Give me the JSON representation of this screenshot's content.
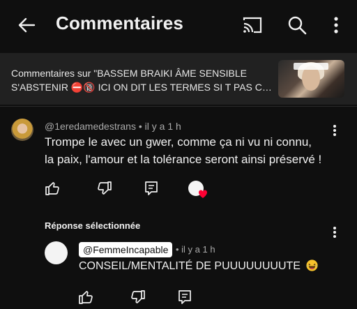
{
  "header": {
    "title": "Commentaires"
  },
  "video": {
    "line1": "Commentaires sur \"BASSEM BRAIKI ÂME SENSIBLE",
    "line2": "S'ABSTENIR ⛔🔞 ICI ON DIT LES TERMES SI T PAS CONT..."
  },
  "comment1": {
    "author": "@1eredamedestrans",
    "time": "il y a 1 h",
    "text": "Trompe le avec un gwer, comme ça ni vu ni connu, la paix, l'amour et la tolérance seront ainsi préservé !"
  },
  "reply_section": {
    "heading": "Réponse sélectionnée"
  },
  "reply": {
    "mention": "@FemmeIncapable",
    "time": "il y a 1 h",
    "text": "CONSEIL/MENTALITÉ DE PUUUUUUUUTE"
  },
  "colors": {
    "background": "#0f0f0f",
    "video_bar": "#212121",
    "heart": "#ff0033"
  },
  "icons": [
    "back-arrow-icon",
    "cast-icon",
    "search-icon",
    "more-vert-icon",
    "thumb-up-icon",
    "thumb-down-icon",
    "reply-icon",
    "creator-heart-icon",
    "laughing-emoji-icon"
  ]
}
